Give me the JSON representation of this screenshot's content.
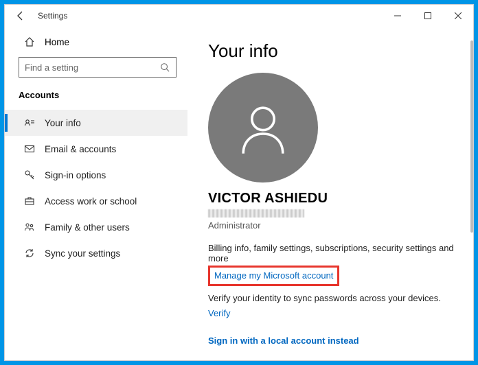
{
  "titlebar": {
    "title": "Settings"
  },
  "sidebar": {
    "home_label": "Home",
    "search_placeholder": "Find a setting",
    "category": "Accounts",
    "items": [
      {
        "label": "Your info"
      },
      {
        "label": "Email & accounts"
      },
      {
        "label": "Sign-in options"
      },
      {
        "label": "Access work or school"
      },
      {
        "label": "Family & other users"
      },
      {
        "label": "Sync your settings"
      }
    ]
  },
  "content": {
    "page_title": "Your info",
    "username": "VICTOR ASHIEDU",
    "role": "Administrator",
    "billing_text": "Billing info, family settings, subscriptions, security settings and more",
    "manage_link": "Manage my Microsoft account",
    "verify_text": "Verify your identity to sync passwords across your devices.",
    "verify_link": "Verify",
    "local_account_link": "Sign in with a local account instead"
  }
}
